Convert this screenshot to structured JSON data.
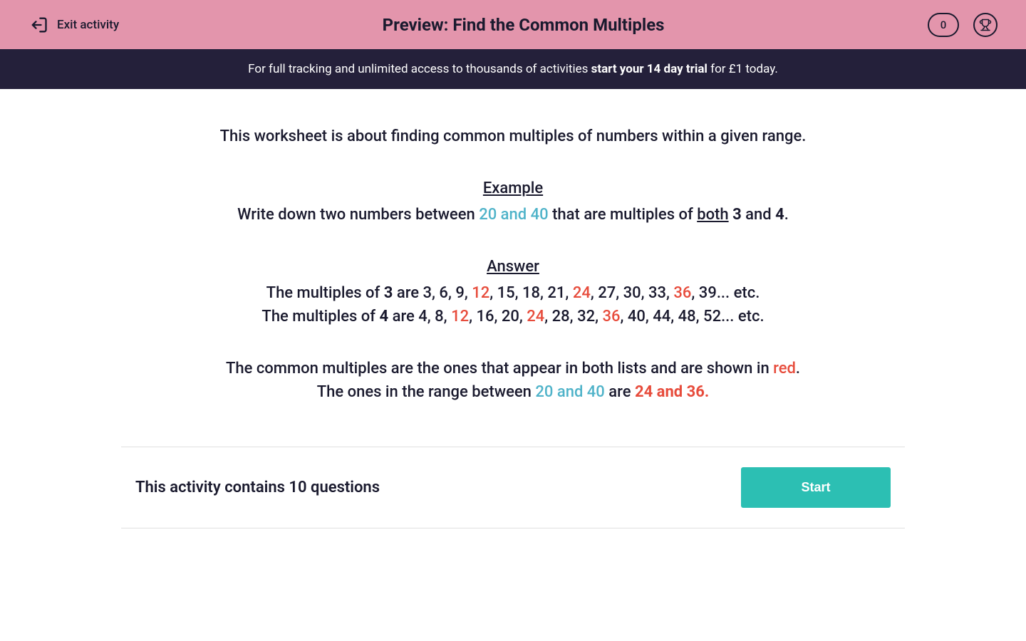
{
  "header": {
    "exit_label": "Exit activity",
    "title": "Preview: Find the Common Multiples",
    "score": "0"
  },
  "banner": {
    "prefix": "For full tracking and unlimited access to thousands of activities ",
    "bold": "start your 14 day trial",
    "suffix": " for £1 today."
  },
  "content": {
    "intro": "This worksheet is about finding common multiples of numbers within a given range.",
    "example_title": "Example",
    "example_line": {
      "p1": "Write down two numbers between ",
      "range": "20 and 40",
      "p2": " that are multiples of ",
      "both": "both",
      "sp1": " ",
      "n1": "3",
      "and": " and ",
      "n2": "4",
      "period": "."
    },
    "answer_title": "Answer",
    "mult3": {
      "p1": "The multiples of ",
      "n": "3",
      "p2": " are 3, 6, 9, ",
      "r1": "12",
      "p3": ", 15, 18, 21, ",
      "r2": "24",
      "p4": ", 27, 30, 33, ",
      "r3": "36",
      "p5": ", 39... etc."
    },
    "mult4": {
      "p1": "The multiples of ",
      "n": "4",
      "p2": " are 4, 8, ",
      "r1": "12",
      "p3": ", 16, 20, ",
      "r2": "24",
      "p4": ", 28, 32, ",
      "r3": "36",
      "p5": ", 40, 44, 48, 52... etc."
    },
    "conclusion1": {
      "p1": "The common multiples are the ones that appear in both lists and are shown in ",
      "red": "red",
      "p2": "."
    },
    "conclusion2": {
      "p1": "The ones in the range between ",
      "range": "20 and 40",
      "p2": " are ",
      "result": "24 and 36."
    }
  },
  "footer": {
    "text": "This activity contains 10 questions",
    "button": "Start"
  },
  "colors": {
    "header_bg": "#e395ac",
    "banner_bg": "#24203a",
    "accent_blue": "#4fb3c9",
    "accent_red": "#e74c3c",
    "button_bg": "#2cbfb3"
  }
}
